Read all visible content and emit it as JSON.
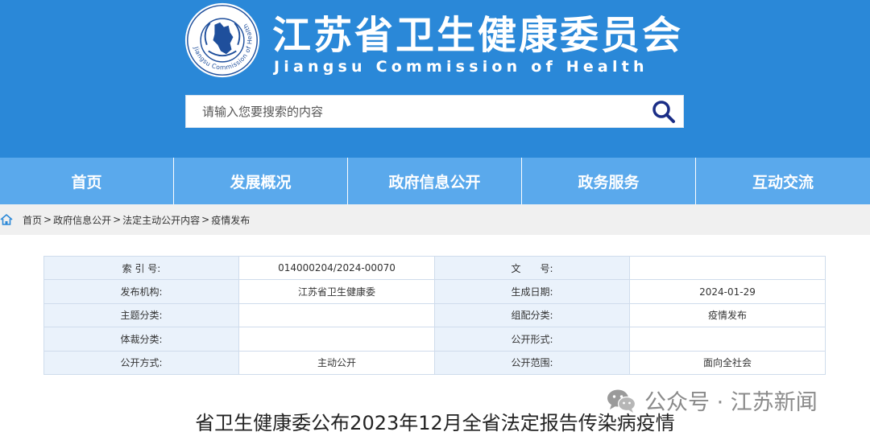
{
  "header": {
    "logo_icon": "jiangsu-health-emblem-icon",
    "emblem_ring_text": "Jiangsu Commission of Health",
    "title_cn": "江苏省卫生健康委员会",
    "title_en": "Jiangsu Commission of Health",
    "background_color": "#2a88d8"
  },
  "search": {
    "placeholder": "请输入您要搜索的内容",
    "icon": "search-icon"
  },
  "nav": {
    "items": [
      "首页",
      "发展概况",
      "政府信息公开",
      "政务服务",
      "互动交流"
    ],
    "background_color": "#5aa9ec"
  },
  "breadcrumb": {
    "icon": "home-icon",
    "items": [
      "首页",
      "政府信息公开",
      "法定主动公开内容",
      "疫情发布"
    ],
    "separator": ">"
  },
  "meta": {
    "rows": [
      {
        "k1": "索 引 号:",
        "v1": "014000204/2024-00070",
        "k2": "文　　号:",
        "v2": ""
      },
      {
        "k1": "发布机构:",
        "v1": "江苏省卫生健康委",
        "k2": "生成日期:",
        "v2": "2024-01-29"
      },
      {
        "k1": "主题分类:",
        "v1": "",
        "k2": "组配分类:",
        "v2": "疫情发布"
      },
      {
        "k1": "体裁分类:",
        "v1": "",
        "k2": "公开形式:",
        "v2": ""
      },
      {
        "k1": "公开方式:",
        "v1": "主动公开",
        "k2": "公开范围:",
        "v2": "面向全社会"
      }
    ]
  },
  "watermark": {
    "icon": "wechat-icon",
    "text": "公众号 · 江苏新闻"
  },
  "article": {
    "title": "省卫生健康委公布2023年12月全省法定报告传染病疫情"
  }
}
